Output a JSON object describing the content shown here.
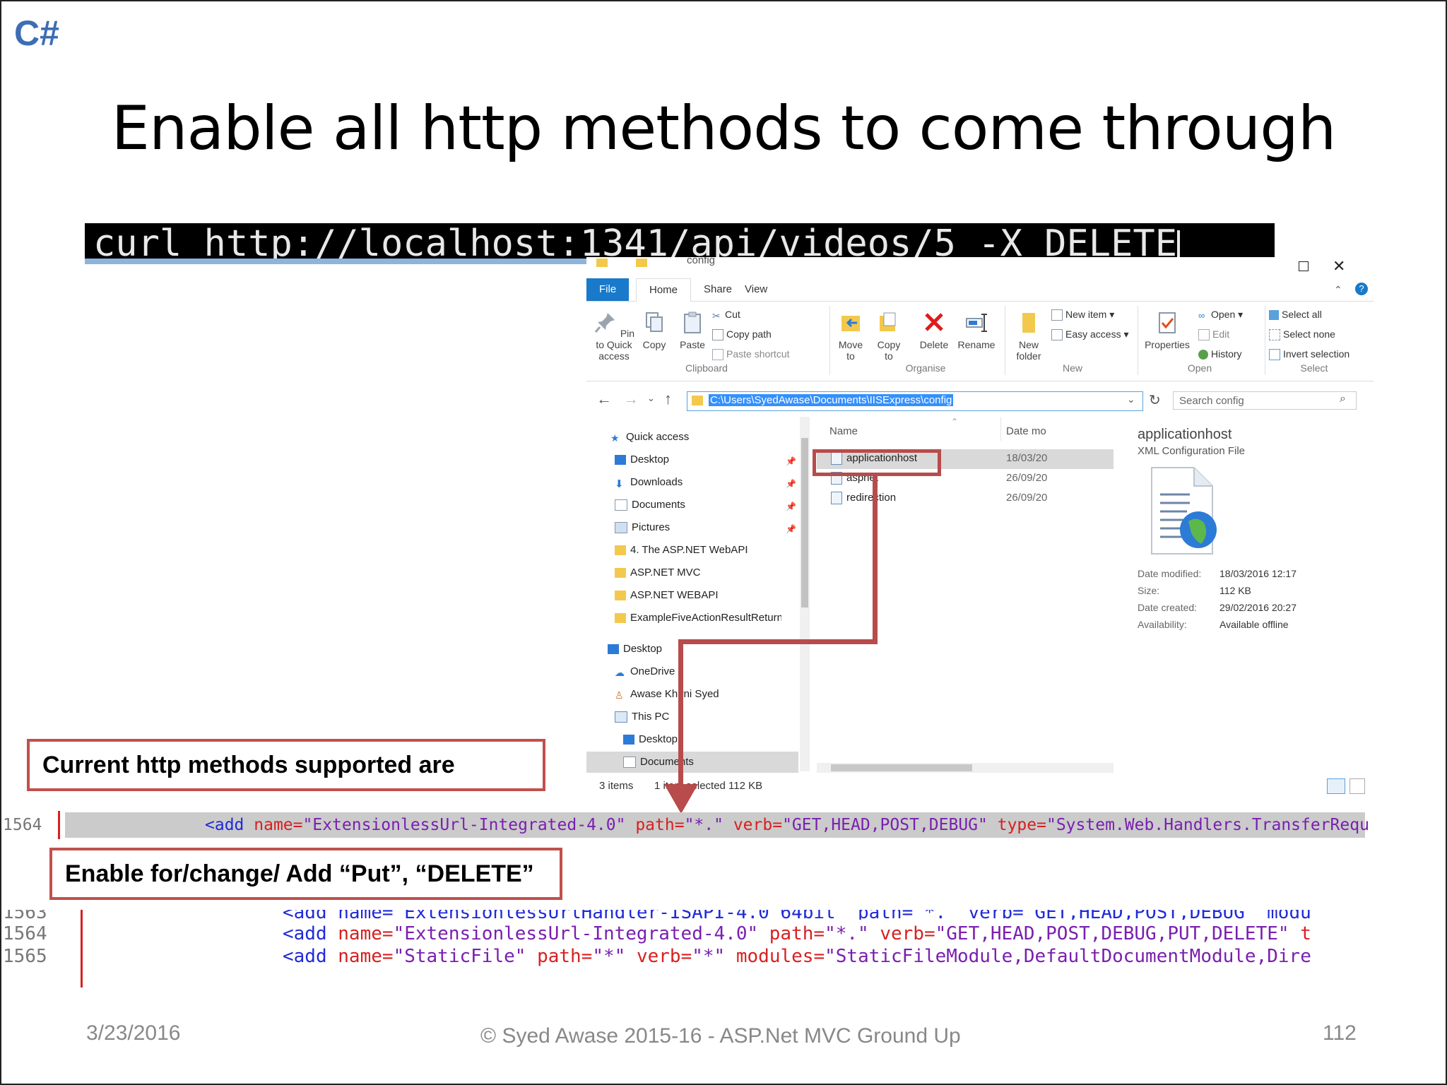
{
  "slide": {
    "logo": "C#",
    "title": "Enable all http methods to come through",
    "command": "curl http://localhost:1341/api/videos/5 -X DELETE",
    "callout_current": "Current http methods supported are",
    "callout_enable": "Enable for/change/ Add “Put”, “DELETE”",
    "footer_date": "3/23/2016",
    "footer_center": "© Syed Awase 2015-16 - ASP.Net MVC Ground Up",
    "footer_page": "112"
  },
  "explorer": {
    "title_partial": "config",
    "tabs": [
      "File",
      "Home",
      "Share",
      "View"
    ],
    "clipboard": {
      "pin": "Pin to Quick access",
      "copy": "Copy",
      "paste": "Paste",
      "cut": "Cut",
      "copy_path": "Copy path",
      "paste_shortcut": "Paste shortcut",
      "group": "Clipboard"
    },
    "organise": {
      "move": "Move to",
      "copy": "Copy to",
      "delete": "Delete",
      "rename": "Rename",
      "group": "Organise"
    },
    "new": {
      "new_folder": "New folder",
      "new_item": "New item",
      "easy_access": "Easy access",
      "group": "New"
    },
    "open": {
      "properties": "Properties",
      "open": "Open",
      "edit": "Edit",
      "history": "History",
      "group": "Open"
    },
    "select": {
      "select_all": "Select all",
      "select_none": "Select none",
      "invert": "Invert selection",
      "group": "Select"
    },
    "address": "C:\\Users\\SyedAwase\\Documents\\IISExpress\\config",
    "search_placeholder": "Search config",
    "nav": [
      "Quick access",
      "Desktop",
      "Downloads",
      "Documents",
      "Pictures",
      "4. The ASP.NET WebAPI",
      "ASP.NET MVC",
      "ASP.NET WEBAPI",
      "ExampleFiveActionResultReturnTy",
      "Desktop",
      "OneDrive",
      "Awase Khirni Syed",
      "This PC",
      "Desktop",
      "Documents"
    ],
    "col_name": "Name",
    "col_date": "Date mo",
    "files": [
      {
        "name": "applicationhost",
        "date": "18/03/20"
      },
      {
        "name": "aspnet",
        "date": "26/09/20"
      },
      {
        "name": "redirection",
        "date": "26/09/20"
      }
    ],
    "details": {
      "name": "applicationhost",
      "type": "XML Configuration File",
      "date_modified_label": "Date modified:",
      "date_modified": "18/03/2016 12:17",
      "size_label": "Size:",
      "size": "112 KB",
      "date_created_label": "Date created:",
      "date_created": "29/02/2016 20:27",
      "availability_label": "Availability:",
      "availability": "Available offline"
    },
    "status_items": "3 items",
    "status_selected": "1 item selected  112 KB"
  },
  "code_before": {
    "line_no": "1564",
    "add": "<add",
    "name_attr": "name=",
    "name_val": "\"ExtensionlessUrl-Integrated-4.0\"",
    "path_attr": "path=",
    "path_val": "\"*.\"",
    "verb_attr": "verb=",
    "verb_val": "\"GET,HEAD,POST,DEBUG\"",
    "type_attr": "type=",
    "type_val": "\"System.Web.Handlers.TransferRequestHandler\""
  },
  "code_after": {
    "line1_no": "1563",
    "line1_text": "<add name=\"ExtensionlessUrlHandler-ISAPI-4.0_64bit\" path=\"*.\" verb=\"GET,HEAD,POST,DEBUG\" modu",
    "line2_no": "1564",
    "line2_add": "<add",
    "line2_name_attr": "name=",
    "line2_name_val": "\"ExtensionlessUrl-Integrated-4.0\"",
    "line2_path_attr": "path=",
    "line2_path_val": "\"*.\"",
    "line2_verb_attr": "verb=",
    "line2_verb_val": "\"GET,HEAD,POST,DEBUG,PUT,DELETE\"",
    "line2_tail": "t",
    "line3_no": "1565",
    "line3_add": "<add",
    "line3_name_attr": "name=",
    "line3_name_val": "\"StaticFile\"",
    "line3_path_attr": "path=",
    "line3_path_val": "\"*\"",
    "line3_verb_attr": "verb=",
    "line3_verb_val": "\"*\"",
    "line3_mod_attr": "modules=",
    "line3_mod_val": "\"StaticFileModule,DefaultDocumentModule,Dire"
  },
  "colors": {
    "accent_red": "#b84b4b",
    "explorer_blue": "#1979ca",
    "logo_blue": "#3d6db4"
  }
}
